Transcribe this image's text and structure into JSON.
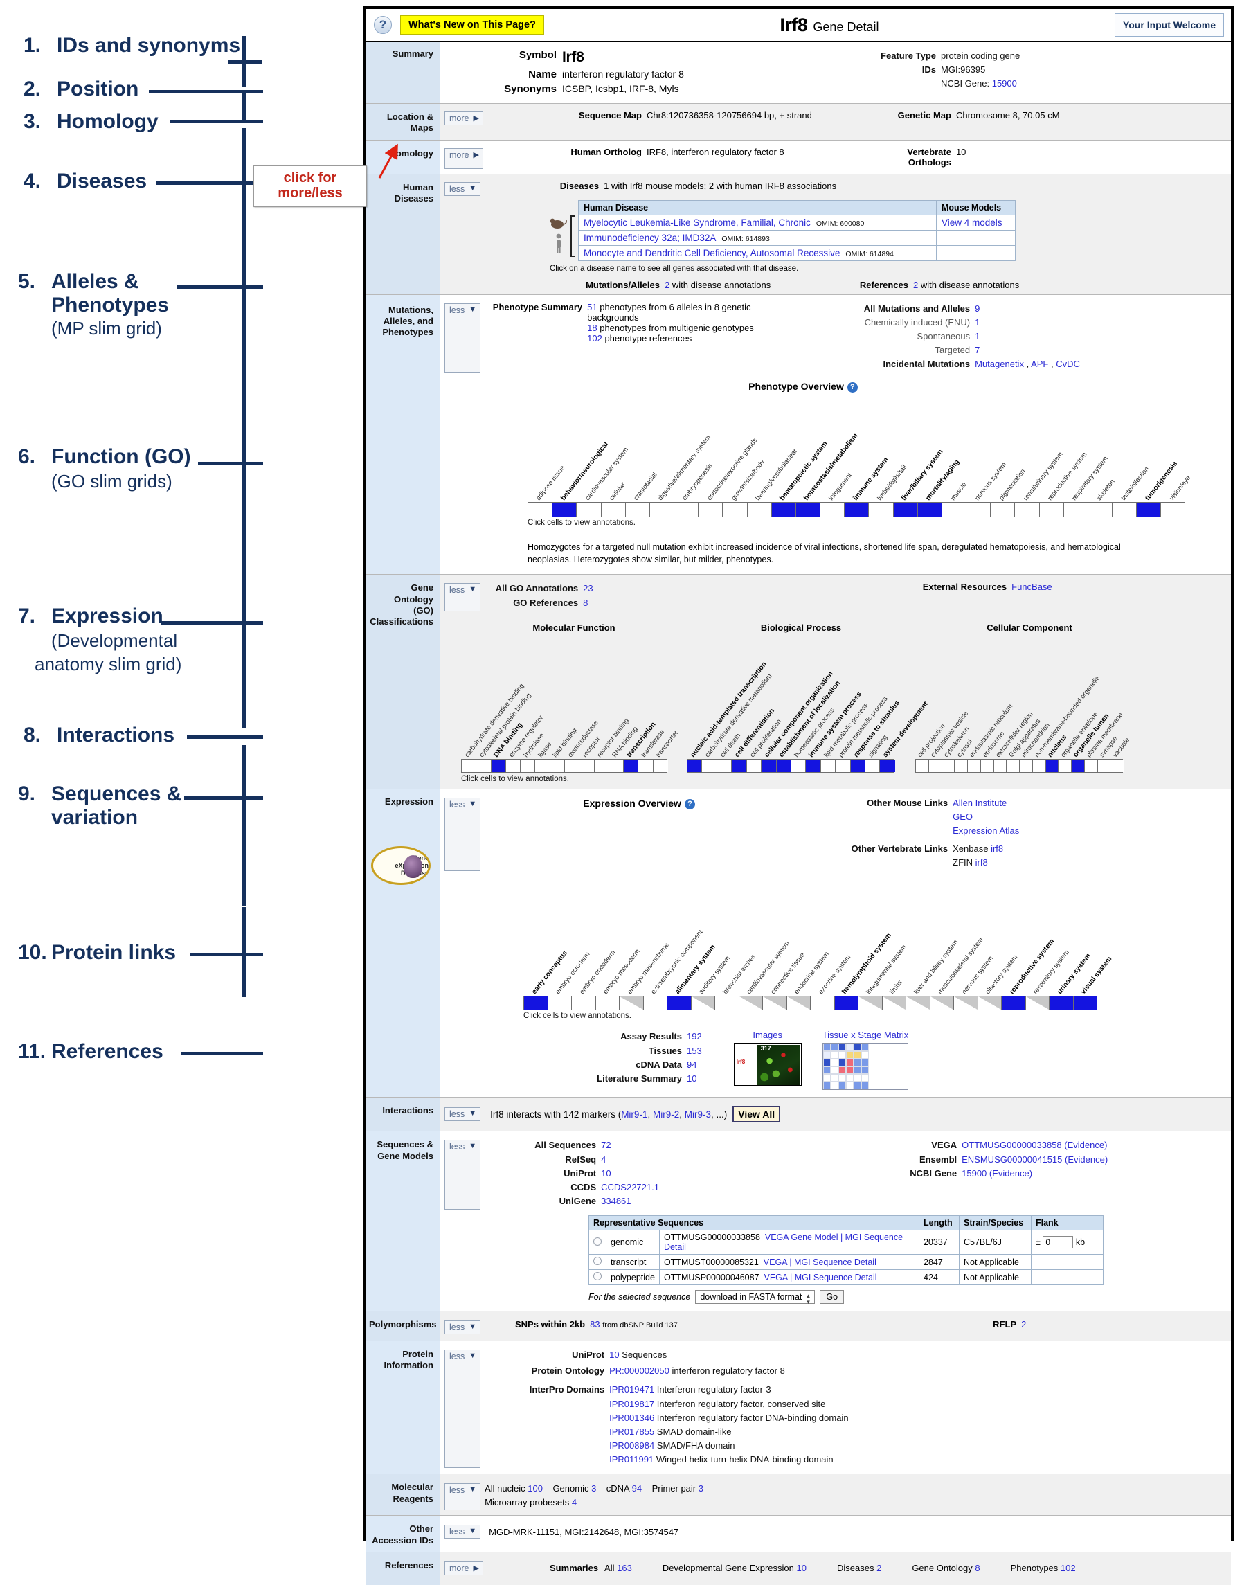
{
  "annotations": [
    {
      "num": "1.",
      "text": "IDs and synonyms",
      "sub": ""
    },
    {
      "num": "2.",
      "text": "Position",
      "sub": ""
    },
    {
      "num": "3.",
      "text": "Homology",
      "sub": ""
    },
    {
      "num": "4.",
      "text": "Diseases",
      "sub": ""
    },
    {
      "num": "5.",
      "text": "Alleles &",
      "text2": "Phenotypes",
      "sub": "(MP slim grid)"
    },
    {
      "num": "6.",
      "text": "Function (GO)",
      "sub": "(GO slim grids)"
    },
    {
      "num": "7.",
      "text": "Expression",
      "sub": "(Developmental",
      "sub2": "anatomy slim grid)"
    },
    {
      "num": "8.",
      "text": "Interactions",
      "sub": ""
    },
    {
      "num": "9.",
      "text": "Sequences &",
      "text2": "variation",
      "sub": ""
    },
    {
      "num": "10.",
      "text": "Protein links",
      "sub": ""
    },
    {
      "num": "11.",
      "text": "References",
      "sub": ""
    }
  ],
  "callout": {
    "line1": "click for",
    "line2": "more/less"
  },
  "header": {
    "help_icon": "?",
    "whats_new": "What's New on This Page?",
    "symbol": "Irf8",
    "subtitle": "Gene Detail",
    "your_input": "Your Input Welcome"
  },
  "summary": {
    "row_label": "Summary",
    "symbol_label": "Symbol",
    "symbol_value": "Irf8",
    "name_label": "Name",
    "name_value": "interferon regulatory factor 8",
    "synonyms_label": "Synonyms",
    "synonyms_value": "ICSBP, Icsbp1, IRF-8, Myls",
    "feature_type_label": "Feature Type",
    "feature_type_value": "protein coding gene",
    "ids_label": "IDs",
    "ids_mgi": "MGI:96395",
    "ids_ncbi_label": "NCBI Gene:",
    "ids_ncbi_value": "15900"
  },
  "location": {
    "row_label": "Location &\nMaps",
    "toggle": "more",
    "seqmap_label": "Sequence Map",
    "seqmap_value": "Chr8:120736358-120756694 bp, + strand",
    "genmap_label": "Genetic Map",
    "genmap_value": "Chromosome 8, 70.05 cM"
  },
  "homology": {
    "row_label": "Homology",
    "toggle": "more",
    "ortholog_label": "Human Ortholog",
    "ortholog_value": "IRF8, interferon regulatory factor 8",
    "vert_label": "Vertebrate Orthologs",
    "vert_value": "10"
  },
  "diseases": {
    "row_label": "Human\nDiseases",
    "toggle": "less",
    "summary_label": "Diseases",
    "summary_value": "1 with Irf8 mouse models; 2 with human IRF8 associations",
    "table_headers": [
      "Human Disease",
      "Mouse Models"
    ],
    "rows": [
      {
        "name": "Myelocytic Leukemia-Like Syndrome, Familial, Chronic",
        "omim": "OMIM: 600080",
        "models": "View 4 models",
        "species": "mouse"
      },
      {
        "name": "Immunodeficiency 32a; IMD32A",
        "omim": "OMIM: 614893",
        "models": "",
        "species": "human"
      },
      {
        "name": "Monocyte and Dendritic Cell Deficiency, Autosomal Recessive",
        "omim": "OMIM: 614894",
        "models": "",
        "species": "human"
      }
    ],
    "note": "Click on a disease name to see all genes associated with that disease.",
    "mut_label": "Mutations/Alleles",
    "mut_num": "2",
    "mut_text": "with disease annotations",
    "refs_label": "References",
    "refs_num": "2",
    "refs_text": "with disease annotations"
  },
  "phenotypes": {
    "row_label": "Mutations,\nAlleles, and\nPhenotypes",
    "toggle": "less",
    "summary_label": "Phenotype Summary",
    "lines": [
      {
        "num": "51",
        "text": "phenotypes from 6 alleles in 8 genetic"
      },
      {
        "num": "",
        "text": "backgrounds"
      },
      {
        "num": "18",
        "text": "phenotypes from multigenic genotypes"
      },
      {
        "num": "102",
        "text": "phenotype references"
      }
    ],
    "right": [
      {
        "label": "All Mutations and Alleles",
        "num": "9",
        "bold": true
      },
      {
        "label": "Chemically induced (ENU)",
        "num": "1",
        "bold": false
      },
      {
        "label": "Spontaneous",
        "num": "1",
        "bold": false
      },
      {
        "label": "Targeted",
        "num": "7",
        "bold": false
      }
    ],
    "incidental_label": "Incidental Mutations",
    "incidental_links": [
      "Mutagenetix",
      "APF",
      "CvDC"
    ],
    "overview_title": "Phenotype Overview",
    "click_note": "Click cells to view annotations.",
    "blurb": "Homozygotes for a targeted null mutation exhibit increased incidence of viral infections, shortened life span, deregulated hematopoiesis, and hematological neoplasias. Heterozygotes show similar, but milder, phenotypes."
  },
  "go": {
    "row_label": "Gene Ontology\n(GO)\nClassifications",
    "toggle": "less",
    "all_label": "All GO Annotations",
    "all_num": "23",
    "refs_label": "GO References",
    "refs_num": "8",
    "ext_label": "External Resources",
    "ext_link": "FuncBase",
    "sub_titles": [
      "Molecular Function",
      "Biological Process",
      "Cellular Component"
    ],
    "click_note": "Click cells to view annotations."
  },
  "expression": {
    "row_label": "Expression",
    "toggle": "less",
    "overview_title": "Expression Overview",
    "click_note": "Click cells to view annotations.",
    "gxd_logo": [
      "Gene",
      "eXpression",
      "Database"
    ],
    "mouse_links_label": "Other Mouse Links",
    "mouse_links": [
      "Allen Institute",
      "GEO",
      "Expression Atlas"
    ],
    "vert_links_label": "Other Vertebrate Links",
    "vert_links": [
      {
        "name": "Xenbase",
        "gene": "irf8"
      },
      {
        "name": "ZFIN",
        "gene": "irf8"
      }
    ],
    "stats": [
      {
        "label": "Assay Results",
        "num": "192"
      },
      {
        "label": "Tissues",
        "num": "153"
      },
      {
        "label": "cDNA Data",
        "num": "94"
      },
      {
        "label": "Literature Summary",
        "num": "10"
      }
    ],
    "images_label": "Images",
    "matrix_label": "Tissue x Stage Matrix",
    "image_caption": "Irf8",
    "image_number": "317"
  },
  "interactions": {
    "row_label": "Interactions",
    "toggle": "less",
    "text_before": "Irf8 interacts with 142 markers (",
    "markers": [
      "Mir9-1",
      "Mir9-2",
      "Mir9-3"
    ],
    "text_after": ", ...)",
    "view_all": "View All"
  },
  "sequences": {
    "row_label": "Sequences &\nGene Models",
    "toggle": "less",
    "left": [
      {
        "label": "All Sequences",
        "num": "72"
      },
      {
        "label": "RefSeq",
        "num": "4"
      },
      {
        "label": "UniProt",
        "num": "10"
      },
      {
        "label": "CCDS",
        "num": "CCDS22721.1"
      },
      {
        "label": "UniGene",
        "num": "334861"
      }
    ],
    "right": [
      {
        "label": "VEGA",
        "value": "OTTMUSG00000033858",
        "evidence": "(Evidence)"
      },
      {
        "label": "Ensembl",
        "value": "ENSMUSG00000041515",
        "evidence": "(Evidence)"
      },
      {
        "label": "NCBI Gene",
        "value": "15900",
        "evidence": "(Evidence)"
      }
    ],
    "table_headers": [
      "Representative Sequences",
      "Length",
      "Strain/Species",
      "Flank"
    ],
    "table_rows": [
      {
        "type": "genomic",
        "acc": "OTTMUSG00000033858",
        "links": "VEGA Gene Model | MGI Sequence Detail",
        "length": "20337",
        "strain": "C57BL/6J",
        "flank_pm": "±",
        "flank_val": "0",
        "flank_unit": "kb"
      },
      {
        "type": "transcript",
        "acc": "OTTMUST00000085321",
        "links": "VEGA | MGI Sequence Detail",
        "length": "2847",
        "strain": "Not Applicable",
        "flank_pm": "",
        "flank_val": "",
        "flank_unit": ""
      },
      {
        "type": "polypeptide",
        "acc": "OTTMUSP00000046087",
        "links": "VEGA | MGI Sequence Detail",
        "length": "424",
        "strain": "Not Applicable",
        "flank_pm": "",
        "flank_val": "",
        "flank_unit": ""
      }
    ],
    "download_prefix": "For the selected sequence",
    "download_option": "download in FASTA format",
    "go_button": "Go"
  },
  "polymorphisms": {
    "row_label": "Polymorphisms",
    "toggle": "less",
    "snp_label": "SNPs within 2kb",
    "snp_num": "83",
    "snp_text": "from dbSNP Build 137",
    "rflp_label": "RFLP",
    "rflp_num": "2"
  },
  "protein": {
    "row_label": "Protein\nInformation",
    "toggle": "less",
    "uniprot_label": "UniProt",
    "uniprot_num": "10",
    "uniprot_text": "Sequences",
    "ontology_label": "Protein Ontology",
    "ontology_id": "PR:000002050",
    "ontology_text": "interferon regulatory factor 8",
    "interpro_label": "InterPro Domains",
    "interpro": [
      {
        "id": "IPR019471",
        "text": "Interferon regulatory factor-3"
      },
      {
        "id": "IPR019817",
        "text": "Interferon regulatory factor, conserved site"
      },
      {
        "id": "IPR001346",
        "text": "Interferon regulatory factor DNA-binding domain"
      },
      {
        "id": "IPR017855",
        "text": "SMAD domain-like"
      },
      {
        "id": "IPR008984",
        "text": "SMAD/FHA domain"
      },
      {
        "id": "IPR011991",
        "text": "Winged helix-turn-helix DNA-binding domain"
      }
    ]
  },
  "reagents": {
    "row_label": "Molecular\nReagents",
    "toggle": "less",
    "items": [
      {
        "label": "All nucleic",
        "num": "100"
      },
      {
        "label": "Genomic",
        "num": "3"
      },
      {
        "label": "cDNA",
        "num": "94"
      },
      {
        "label": "Primer pair",
        "num": "3"
      }
    ],
    "probesets_label": "Microarray probesets",
    "probesets_num": "4"
  },
  "other_ids": {
    "row_label": "Other\nAccession IDs",
    "toggle": "less",
    "value": "MGD-MRK-11151, MGI:2142648, MGI:3574547"
  },
  "references": {
    "row_label": "References",
    "toggle": "more",
    "summaries_label": "Summaries",
    "items": [
      {
        "label": "All",
        "num": "163"
      },
      {
        "label": "Developmental Gene Expression",
        "num": "10"
      },
      {
        "label": "Diseases",
        "num": "2"
      },
      {
        "label": "Gene Ontology",
        "num": "8"
      },
      {
        "label": "Phenotypes",
        "num": "102"
      }
    ]
  },
  "chart_data": [
    {
      "type": "heatmap",
      "title": "Phenotype Overview",
      "name": "mp-slim-grid",
      "categories": [
        "adipose tissue",
        "behavior/neurological",
        "cardiovascular system",
        "cellular",
        "craniofacial",
        "digestive/alimentary system",
        "embryogenesis",
        "endocrine/exocrine glands",
        "growth/size/body",
        "hearing/vestibular/ear",
        "hematopoietic system",
        "homeostasis/metabolism",
        "integument",
        "immune system",
        "limbs/digits/tail",
        "liver/biliary system",
        "mortality/aging",
        "muscle",
        "nervous system",
        "pigmentation",
        "renal/urinary system",
        "reproductive system",
        "respiratory system",
        "skeleton",
        "taste/olfaction",
        "tumorigenesis",
        "vision/eye"
      ],
      "values": [
        0,
        1,
        0,
        0,
        0,
        0,
        0,
        0,
        0,
        0,
        1,
        1,
        0,
        1,
        0,
        1,
        1,
        0,
        0,
        0,
        0,
        0,
        0,
        0,
        0,
        1,
        0
      ],
      "legend": "1 = annotated (blue), 0 = no annotation (white)"
    },
    {
      "type": "heatmap",
      "title": "Molecular Function",
      "name": "go-molecular-function-grid",
      "categories": [
        "carbohydrate derivative binding",
        "cytoskeletal protein binding",
        "DNA binding",
        "enzyme regulator",
        "hydrolase",
        "ligase",
        "lipid binding",
        "oxidoreductase",
        "receptor",
        "receptor binding",
        "RNA binding",
        "transcription",
        "transferase",
        "transporter"
      ],
      "values": [
        0,
        0,
        1,
        0,
        0,
        0,
        0,
        0,
        0,
        0,
        0,
        1,
        0,
        0
      ]
    },
    {
      "type": "heatmap",
      "title": "Biological Process",
      "name": "go-biological-process-grid",
      "categories": [
        "nucleic acid-templated transcription",
        "carbohydrate derivative metabolism",
        "cell death",
        "cell differentiation",
        "cell proliferation",
        "cellular component organization",
        "establishment of localization",
        "homeostatic process",
        "immune system process",
        "lipid metabolic process",
        "protein metabolic process",
        "response to stimulus",
        "signaling",
        "system development"
      ],
      "values": [
        1,
        0,
        0,
        1,
        0,
        1,
        1,
        0,
        1,
        0,
        0,
        1,
        0,
        1
      ]
    },
    {
      "type": "heatmap",
      "title": "Cellular Component",
      "name": "go-cellular-component-grid",
      "categories": [
        "cell projection",
        "cytoplasmic vesicle",
        "cytoskeleton",
        "cytosol",
        "endoplasmic reticulum",
        "endosome",
        "extracellular region",
        "Golgi apparatus",
        "mitochondrion",
        "non-membrane-bounded organelle",
        "nucleus",
        "organelle envelope",
        "organelle lumen",
        "plasma membrane",
        "synapse",
        "vacuole"
      ],
      "values": [
        0,
        0,
        0,
        0,
        0,
        0,
        0,
        0,
        0,
        0,
        1,
        0,
        1,
        0,
        0,
        0
      ]
    },
    {
      "type": "heatmap",
      "title": "Expression Overview",
      "name": "expression-anatomy-grid",
      "categories": [
        "early conceptus",
        "embryo ectoderm",
        "embryo endoderm",
        "embryo mesoderm",
        "embryo mesenchyme",
        "extraembryonic component",
        "alimentary system",
        "auditory system",
        "branchial arches",
        "cardiovascular system",
        "connective tissue",
        "endocrine system",
        "exocrine system",
        "hemolymphoid system",
        "integumental system",
        "limbs",
        "liver and biliary system",
        "musculoskeletal system",
        "nervous system",
        "olfactory system",
        "reproductive system",
        "respiratory system",
        "urinary system",
        "visual system"
      ],
      "values": [
        2,
        0,
        0,
        0,
        1,
        0,
        2,
        1,
        0,
        1,
        1,
        1,
        0,
        2,
        1,
        1,
        1,
        1,
        1,
        1,
        2,
        1,
        2,
        2
      ],
      "legend": "2 = detected (blue), 1 = partial/gray triangle, 0 = none"
    }
  ]
}
